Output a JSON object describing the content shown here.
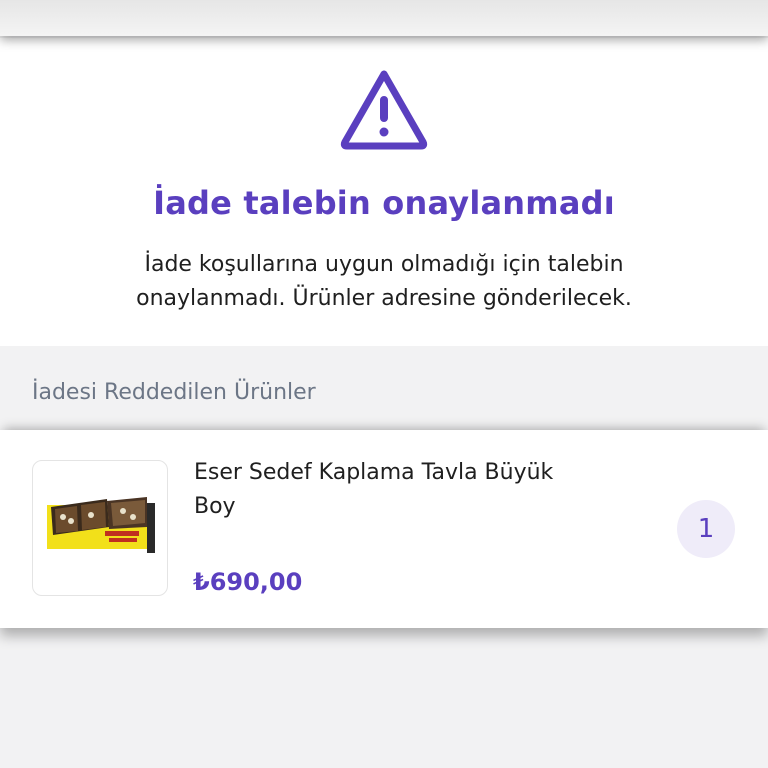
{
  "status": {
    "icon": "warning-triangle-icon",
    "title": "İade talebin onaylanmadı",
    "description": "İade koşullarına uygun olmadığı için talebin onaylanmadı. Ürünler adresine gönderilecek.",
    "accent_color": "#5a3fbf"
  },
  "rejected_section": {
    "title": "İadesi Reddedilen Ürünler",
    "items": [
      {
        "name": "Eser Sedef Kaplama Tavla Büyük Boy",
        "price": "₺690,00",
        "quantity": "1",
        "image_icon": "backgammon-board-image"
      }
    ]
  }
}
